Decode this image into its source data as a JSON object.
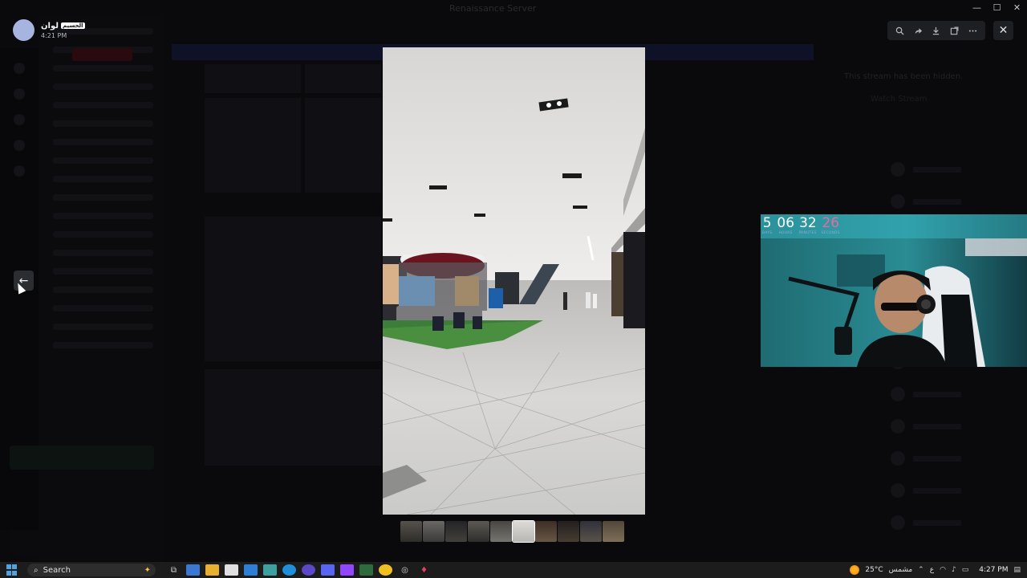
{
  "window": {
    "title": "Renaissance Server",
    "controls": [
      "—",
      "☐",
      "✕"
    ]
  },
  "viewer": {
    "uploader": {
      "name": "لوان",
      "tag": "الحسيم",
      "time": "4:21 PM"
    },
    "toolbar": {
      "zoom_icon": "zoom-icon",
      "forward_icon": "forward-icon",
      "download_icon": "download-icon",
      "open_external_icon": "open-external-icon",
      "more_icon": "more-icon"
    },
    "close_label": "✕",
    "prev_label": "←",
    "thumbnail_count": 10,
    "active_thumbnail": 6
  },
  "background": {
    "stream_hidden_text": "This stream has been hidden.",
    "watch_stream_label": "Watch Stream"
  },
  "webcam": {
    "countdown": [
      {
        "value": "5",
        "label": "DAYS"
      },
      {
        "value": "06",
        "label": "HOURS"
      },
      {
        "value": "32",
        "label": "MINUTES"
      },
      {
        "value": "26",
        "label": "SECONDS"
      }
    ]
  },
  "taskbar": {
    "search_label": "Search",
    "weather_temp": "25°C",
    "weather_desc": "مشمس",
    "language": "ع",
    "clock": "4:27 PM"
  },
  "colors": {
    "accent": "#5865f2",
    "countdown_highlight": "#e86aa0",
    "taskbar_bg": "#1c1c1c"
  }
}
